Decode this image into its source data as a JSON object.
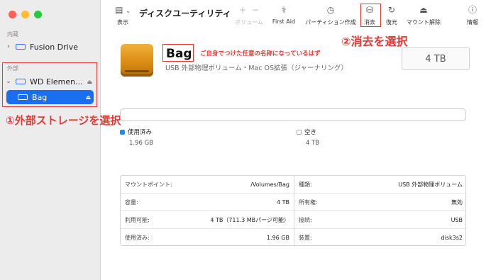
{
  "sidebar": {
    "internal_label": "内蔵",
    "external_label": "外部",
    "items": [
      {
        "label": "Fusion Drive"
      },
      {
        "label": "WD Elemen..."
      },
      {
        "label": "Bag"
      }
    ]
  },
  "toolbar": {
    "view_label": "表示",
    "title": "ディスクユーティリティ",
    "volume_label": "ボリューム",
    "volume_plus": "+",
    "volume_minus": "−",
    "firstaid_label": "First Aid",
    "partition_label": "パーティション作成",
    "erase_label": "消去",
    "restore_label": "復元",
    "unmount_label": "マウント解除",
    "info_label": "情報"
  },
  "volume": {
    "name": "Bag",
    "subtitle": "USB 外部物理ボリューム・Mac OS拡張（ジャーナリング）",
    "capacity": "4 TB"
  },
  "usage": {
    "used_label": "使用済み",
    "used_value": "1.96 GB",
    "free_label": "空き",
    "free_value": "4 TB",
    "used_color": "#1a8cff"
  },
  "info": {
    "left": [
      {
        "key": "マウントポイント:",
        "value": "/Volumes/Bag"
      },
      {
        "key": "容量:",
        "value": "4 TB"
      },
      {
        "key": "利用可能:",
        "value": "4 TB（711.3 MBパージ可能）"
      },
      {
        "key": "使用済み:",
        "value": "1.96 GB"
      }
    ],
    "right": [
      {
        "key": "種類:",
        "value": "USB 外部物理ボリューム"
      },
      {
        "key": "所有権:",
        "value": "無効"
      },
      {
        "key": "接続:",
        "value": "USB"
      },
      {
        "key": "装置:",
        "value": "disk3s2"
      }
    ]
  },
  "annotations": {
    "name_note": "ご自身でつけた任意の名称になっているはず",
    "step1": "①外部ストレージを選択",
    "step2": "②消去を選択",
    "color": "#e53935"
  },
  "icons": {
    "chevron_right": "›",
    "chevron_down": "⌄",
    "eject": "⏏",
    "sidebar_toggle": "▤",
    "volume": "±",
    "firstaid": "⚕",
    "partition": "◷",
    "erase": "⛁",
    "restore": "↻",
    "unmount": "⏏",
    "info": "ⓘ"
  }
}
